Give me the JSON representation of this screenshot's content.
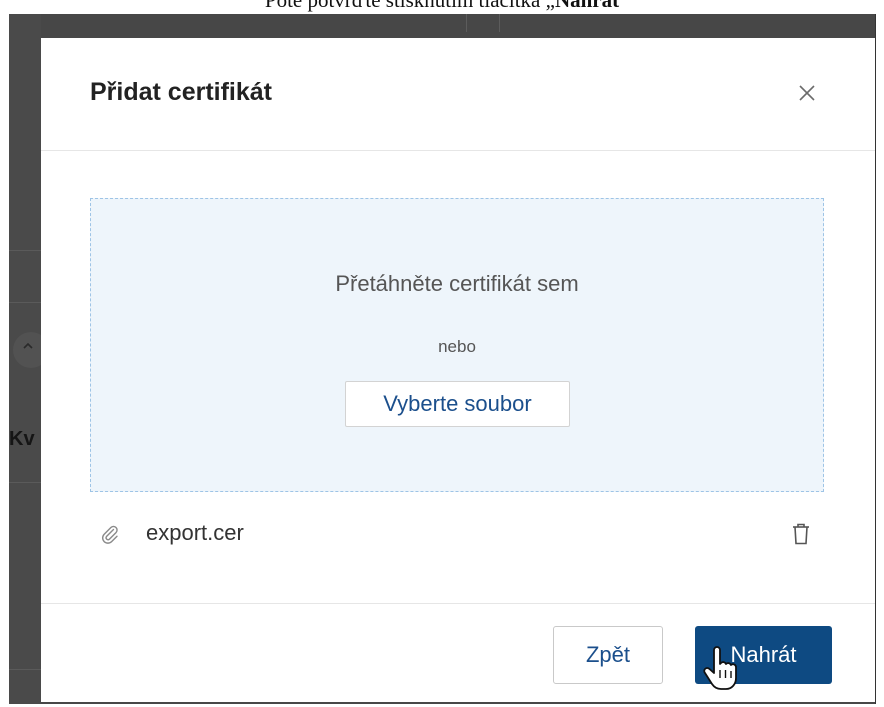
{
  "caption": {
    "text_prefix": "Poté potvrďte stisknutím tlačítka „",
    "text_bold": "Nahrát"
  },
  "background": {
    "partial_label": "Kv"
  },
  "modal": {
    "title": "Přidat certifikát",
    "close_icon": "close-icon",
    "dropzone": {
      "title": "Přetáhněte certifikát sem",
      "or_text": "nebo",
      "choose_button": "Vyberte soubor"
    },
    "file": {
      "name": "export.cer",
      "attach_icon": "paperclip-icon",
      "delete_icon": "trash-icon"
    },
    "footer": {
      "back_label": "Zpět",
      "upload_label": "Nahrát"
    }
  },
  "colors": {
    "primary": "#0e4a82",
    "link": "#1b4f8c",
    "overlay": "#474747",
    "dropzone_bg": "#eef5fb",
    "dropzone_border": "#9ec4e6"
  }
}
